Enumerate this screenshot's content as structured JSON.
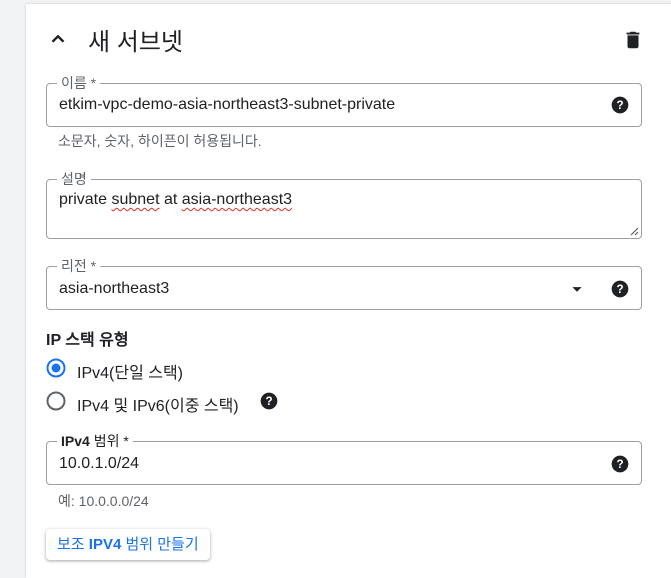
{
  "header": {
    "title": "새 서브넷"
  },
  "name_field": {
    "label": "이름 *",
    "value": "etkim-vpc-demo-asia-northeast3-subnet-private",
    "hint": "소문자, 숫자, 하이픈이 허용됩니다."
  },
  "description_field": {
    "label": "설명",
    "value_part1": "private ",
    "value_part2": "subnet",
    "value_part3": " at ",
    "value_part4": "asia-northeast3"
  },
  "region_field": {
    "label": "리전 *",
    "value": "asia-northeast3"
  },
  "ip_stack": {
    "title": "IP 스택 유형",
    "options": [
      {
        "label": "IPv4(단일 스택)",
        "selected": true
      },
      {
        "label": "IPv4 및 IPv6(이중 스택)",
        "selected": false
      }
    ]
  },
  "ipv4_range_field": {
    "label_bold": "IPv4",
    "label_rest": " 범위 *",
    "value": "10.0.1.0/24",
    "hint": "예: 10.0.0.0/24"
  },
  "secondary_button": {
    "label_prefix": "보조 ",
    "label_bold": "IPV4",
    "label_suffix": " 범위 만들기"
  },
  "colors": {
    "accent": "#1a73e8",
    "error_squiggle": "#d93025",
    "text": "#202124",
    "muted": "#5f6368"
  },
  "icons": [
    "chevron-up-icon",
    "trash-icon",
    "help-icon",
    "dropdown-arrow-icon",
    "resize-handle-icon"
  ]
}
